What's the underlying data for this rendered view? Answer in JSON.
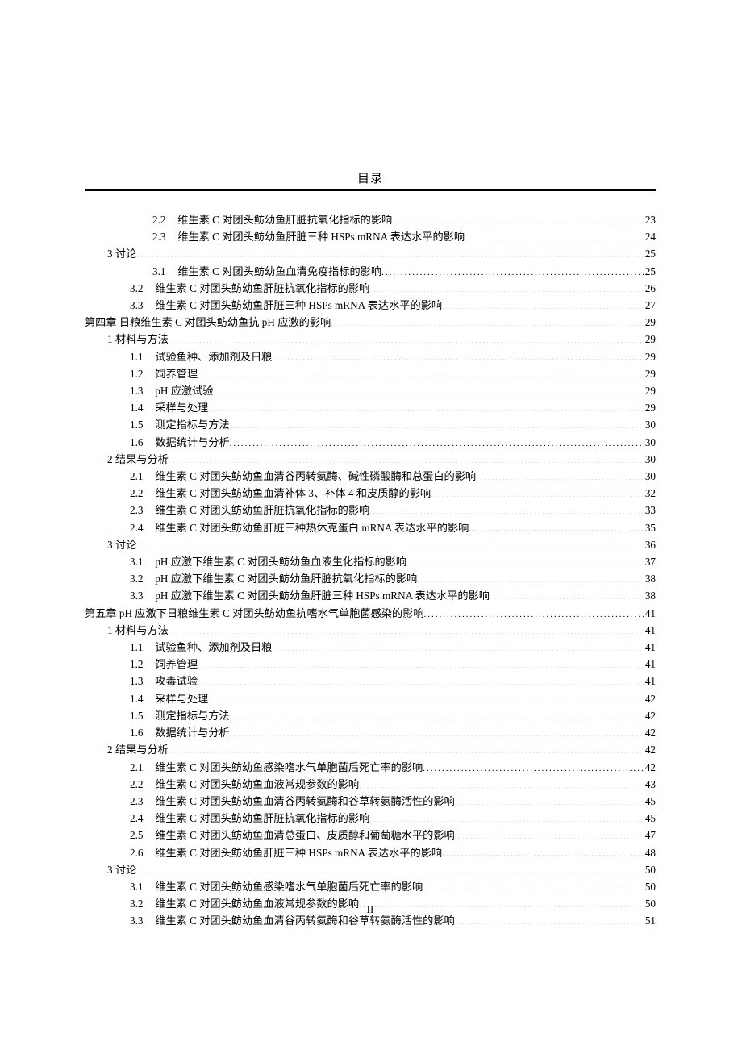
{
  "header": {
    "title": "目录"
  },
  "footer": {
    "page_number": "II"
  },
  "toc": [
    {
      "level": 3,
      "num": "2.2",
      "text": "维生素 C 对团头鲂幼鱼肝脏抗氧化指标的影响",
      "page": "23"
    },
    {
      "level": 3,
      "num": "2.3",
      "text": "维生素 C 对团头鲂幼鱼肝脏三种 HSPs mRNA 表达水平的影响",
      "page": "24"
    },
    {
      "level": 1,
      "num": "3",
      "text": "讨论",
      "page": "25"
    },
    {
      "level": 3,
      "num": "3.1",
      "text": "维生素 C 对团头鲂幼鱼血清免疫指标的影响",
      "page": "25"
    },
    {
      "level": 2,
      "num": "3.2",
      "text": "维生素 C 对团头鲂幼鱼肝脏抗氧化指标的影响",
      "page": "26"
    },
    {
      "level": 2,
      "num": "3.3",
      "text": "维生素 C 对团头鲂幼鱼肝脏三种 HSPs mRNA 表达水平的影响",
      "page": "27"
    },
    {
      "level": 0,
      "num": "第四章",
      "text": "日粮维生素 C 对团头鲂幼鱼抗 pH 应激的影响",
      "page": "29"
    },
    {
      "level": 1,
      "num": "1",
      "text": "材料与方法",
      "page": "29"
    },
    {
      "level": 2,
      "num": "1.1",
      "text": "试验鱼种、添加剂及日粮",
      "page": "29"
    },
    {
      "level": 2,
      "num": "1.2",
      "text": "饲养管理",
      "page": "29"
    },
    {
      "level": 2,
      "num": "1.3",
      "text": "pH 应激试验",
      "page": "29"
    },
    {
      "level": 2,
      "num": "1.4",
      "text": "采样与处理",
      "page": "29"
    },
    {
      "level": 2,
      "num": "1.5",
      "text": "测定指标与方法",
      "page": "30"
    },
    {
      "level": 2,
      "num": "1.6",
      "text": "数据统计与分析",
      "page": "30"
    },
    {
      "level": 1,
      "num": "2",
      "text": "结果与分析",
      "page": "30"
    },
    {
      "level": 2,
      "num": "2.1",
      "text": "维生素 C 对团头鲂幼鱼血清谷丙转氨酶、碱性磷酸酶和总蛋白的影响",
      "page": "30"
    },
    {
      "level": 2,
      "num": "2.2",
      "text": "维生素 C 对团头鲂幼鱼血清补体 3、补体 4 和皮质醇的影响",
      "page": "32"
    },
    {
      "level": 2,
      "num": "2.3",
      "text": "维生素 C 对团头鲂幼鱼肝脏抗氧化指标的影响",
      "page": "33"
    },
    {
      "level": 2,
      "num": "2.4",
      "text": "维生素 C 对团头鲂幼鱼肝脏三种热休克蛋白 mRNA 表达水平的影响",
      "page": "35"
    },
    {
      "level": 1,
      "num": "3",
      "text": "讨论",
      "page": "36"
    },
    {
      "level": 2,
      "num": "3.1",
      "text": "pH 应激下维生素 C 对团头鲂幼鱼血液生化指标的影响",
      "page": "37"
    },
    {
      "level": 2,
      "num": "3.2",
      "text": "pH 应激下维生素 C 对团头鲂幼鱼肝脏抗氧化指标的影响",
      "page": "38"
    },
    {
      "level": 2,
      "num": "3.3",
      "text": "pH 应激下维生素 C 对团头鲂幼鱼肝脏三种 HSPs mRNA 表达水平的影响",
      "page": "38"
    },
    {
      "level": 0,
      "num": "第五章",
      "text": "pH 应激下日粮维生素 C 对团头鲂幼鱼抗嗜水气单胞菌感染的影响",
      "page": "41"
    },
    {
      "level": 1,
      "num": "1",
      "text": "材料与方法",
      "page": "41"
    },
    {
      "level": 2,
      "num": "1.1",
      "text": "试验鱼种、添加剂及日粮",
      "page": "41"
    },
    {
      "level": 2,
      "num": "1.2",
      "text": "饲养管理",
      "page": "41"
    },
    {
      "level": 2,
      "num": "1.3",
      "text": "攻毒试验",
      "page": "41"
    },
    {
      "level": 2,
      "num": "1.4",
      "text": "采样与处理",
      "page": "42"
    },
    {
      "level": 2,
      "num": "1.5",
      "text": "测定指标与方法",
      "page": "42"
    },
    {
      "level": 2,
      "num": "1.6",
      "text": "数据统计与分析",
      "page": "42"
    },
    {
      "level": 1,
      "num": "2",
      "text": "结果与分析",
      "page": "42"
    },
    {
      "level": 2,
      "num": "2.1",
      "text": "维生素 C 对团头鲂幼鱼感染嗜水气单胞菌后死亡率的影响",
      "page": "42"
    },
    {
      "level": 2,
      "num": "2.2",
      "text": "维生素 C 对团头鲂幼鱼血液常规参数的影响",
      "page": "43"
    },
    {
      "level": 2,
      "num": "2.3",
      "text": "维生素 C 对团头鲂幼鱼血清谷丙转氨酶和谷草转氨酶活性的影响",
      "page": "45"
    },
    {
      "level": 2,
      "num": "2.4",
      "text": "维生素 C 对团头鲂幼鱼肝脏抗氧化指标的影响",
      "page": "45"
    },
    {
      "level": 2,
      "num": "2.5",
      "text": "维生素 C 对团头鲂幼鱼血清总蛋白、皮质醇和葡萄糖水平的影响",
      "page": "47"
    },
    {
      "level": 2,
      "num": "2.6",
      "text": "维生素 C 对团头鲂幼鱼肝脏三种 HSPs mRNA 表达水平的影响",
      "page": "48"
    },
    {
      "level": 1,
      "num": "3",
      "text": "讨论",
      "page": "50"
    },
    {
      "level": 2,
      "num": "3.1",
      "text": "维生素 C 对团头鲂幼鱼感染嗜水气单胞菌后死亡率的影响",
      "page": "50"
    },
    {
      "level": 2,
      "num": "3.2",
      "text": "维生素 C 对团头鲂幼鱼血液常规参数的影响",
      "page": "50"
    },
    {
      "level": 2,
      "num": "3.3",
      "text": "维生素 C 对团头鲂幼鱼血清谷丙转氨酶和谷草转氨酶活性的影响",
      "page": "51"
    }
  ]
}
